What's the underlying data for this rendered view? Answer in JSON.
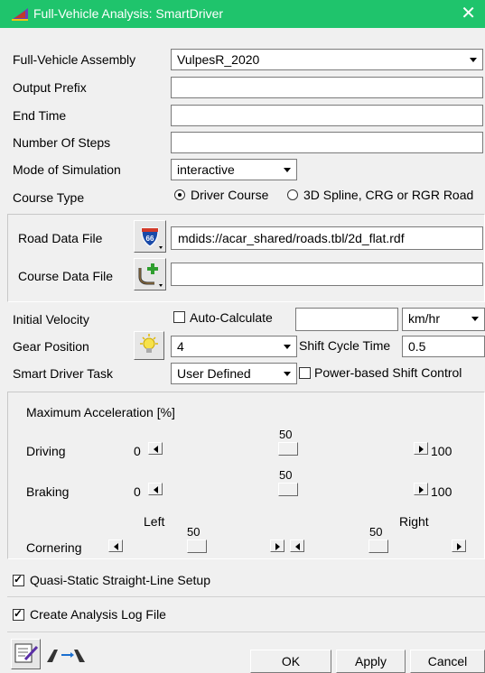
{
  "window": {
    "title": "Full-Vehicle Analysis: SmartDriver",
    "close_glyph": "✕",
    "accent": "#1fc46c"
  },
  "assembly": {
    "label": "Full-Vehicle Assembly",
    "value": "VulpesR_2020"
  },
  "output_prefix": {
    "label": "Output Prefix",
    "value": ""
  },
  "end_time": {
    "label": "End Time",
    "value": ""
  },
  "num_steps": {
    "label": "Number Of Steps",
    "value": ""
  },
  "mode": {
    "label": "Mode of Simulation",
    "value": "interactive"
  },
  "course_type": {
    "label": "Course Type",
    "options": [
      "Driver Course",
      "3D Spline, CRG or RGR Road"
    ],
    "selected": "Driver Course"
  },
  "road_data": {
    "label": "Road Data File",
    "value": "mdids://acar_shared/roads.tbl/2d_flat.rdf",
    "icon_text": "66"
  },
  "course_data": {
    "label": "Course Data File",
    "value": ""
  },
  "initial_velocity": {
    "label": "Initial Velocity",
    "auto_label": "Auto-Calculate",
    "auto_checked": false,
    "value": "",
    "unit": "km/hr"
  },
  "gear": {
    "label": "Gear Position",
    "value": "4",
    "shift_label": "Shift Cycle Time",
    "shift_value": "0.5"
  },
  "task": {
    "label": "Smart Driver Task",
    "value": "User Defined",
    "power_label": "Power-based Shift Control",
    "power_checked": false
  },
  "accel": {
    "title": "Maximum Acceleration [%]",
    "driving": {
      "label": "Driving",
      "value": "50",
      "min": "0",
      "max": "100",
      "fraction": 0.5
    },
    "braking": {
      "label": "Braking",
      "value": "50",
      "min": "0",
      "max": "100",
      "fraction": 0.5
    },
    "cornering": {
      "label": "Cornering",
      "left_label": "Left",
      "right_label": "Right",
      "left_value": "50",
      "right_value": "50",
      "left_fraction": 0.5,
      "right_fraction": 0.5
    }
  },
  "quasi_static": {
    "label": "Quasi-Static Straight-Line Setup",
    "checked": true
  },
  "log_file": {
    "label": "Create Analysis Log File",
    "checked": true
  },
  "buttons": {
    "ok": "OK",
    "apply": "Apply",
    "cancel": "Cancel"
  }
}
